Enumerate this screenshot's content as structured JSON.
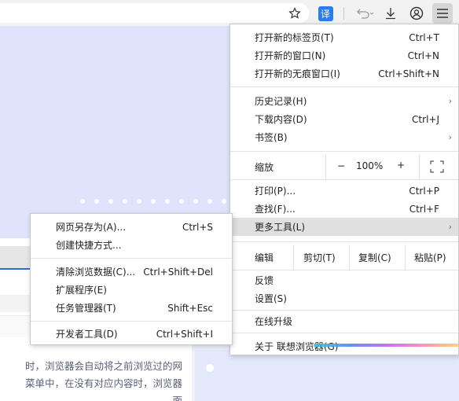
{
  "toolbar": {
    "icons": [
      "star-icon",
      "translate-icon",
      "undo-icon",
      "download-icon",
      "account-icon",
      "menu-icon"
    ],
    "translate_glyph": "译",
    "translate_color": "#2d7bf4"
  },
  "page": {
    "paragraph_lines": [
      "时，浏览器会自动将之前浏览过的网",
      "菜单中，在没有对应内容时，浏览器",
      "面"
    ],
    "accent_color": "#2d6be3"
  },
  "main_menu": {
    "group1": [
      {
        "label": "打开新的标签页(T)",
        "shortcut": "Ctrl+T"
      },
      {
        "label": "打开新的窗口(N)",
        "shortcut": "Ctrl+N"
      },
      {
        "label": "打开新的无痕窗口(I)",
        "shortcut": "Ctrl+Shift+N"
      }
    ],
    "group2": [
      {
        "label": "历史记录(H)",
        "arrow": "›"
      },
      {
        "label": "下载内容(D)",
        "shortcut": "Ctrl+J"
      },
      {
        "label": "书签(B)",
        "arrow": "›"
      }
    ],
    "zoom": {
      "label": "缩放",
      "minus": "−",
      "value": "100%",
      "plus": "+",
      "fullscreen_icon": "fullscreen-icon"
    },
    "group3": [
      {
        "label": "打印(P)...",
        "shortcut": "Ctrl+P"
      },
      {
        "label": "查找(F)...",
        "shortcut": "Ctrl+F"
      },
      {
        "label": "更多工具(L)",
        "arrow": "›"
      }
    ],
    "edit": {
      "label": "编辑",
      "cut": "剪切(T)",
      "copy": "复制(C)",
      "paste": "粘贴(P)"
    },
    "group4": [
      {
        "label": "反馈"
      },
      {
        "label": "设置(S)"
      }
    ],
    "upgrade": "在线升级",
    "about": "关于 联想浏览器(G)"
  },
  "sub_menu": {
    "group1": [
      {
        "label": "网页另存为(A)...",
        "shortcut": "Ctrl+S"
      },
      {
        "label": "创建快捷方式..."
      }
    ],
    "group2": [
      {
        "label": "清除浏览数据(C)...",
        "shortcut": "Ctrl+Shift+Del"
      },
      {
        "label": "扩展程序(E)"
      },
      {
        "label": "任务管理器(T)",
        "shortcut": "Shift+Esc"
      }
    ],
    "group3": [
      {
        "label": "开发者工具(D)",
        "shortcut": "Ctrl+Shift+I"
      }
    ]
  }
}
